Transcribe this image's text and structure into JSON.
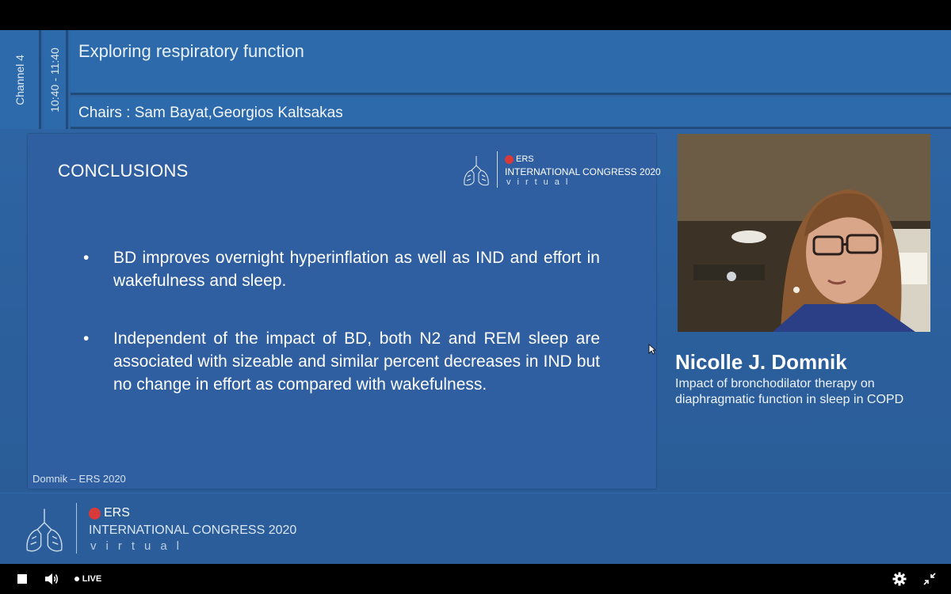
{
  "session": {
    "channel": "Channel 4",
    "time": "10:40 - 11:40",
    "title": "Exploring respiratory function",
    "chairs": "Chairs : Sam Bayat,Georgios Kaltsakas"
  },
  "slide": {
    "title": "CONCLUSIONS",
    "bullet_symbol": "•",
    "bullets": [
      "BD improves overnight hyperinflation as well as IND and effort in wakefulness and sleep.",
      "Independent of the impact of BD, both N2 and REM sleep are associated with sizeable and similar percent decreases in IND but no change in effort as compared with wakefulness."
    ],
    "footer": "Domnik – ERS 2020"
  },
  "logo": {
    "ers": "ERS",
    "congress": "INTERNATIONAL CONGRESS 2020",
    "virtual": "virtual"
  },
  "speaker": {
    "name": "Nicolle J. Domnik",
    "talk_title": "Impact of bronchodilator therapy on diaphragmatic function in sleep in COPD"
  },
  "player": {
    "live_label": "LIVE",
    "icons": [
      "stop-icon",
      "volume-icon",
      "live-dot-icon",
      "gear-icon",
      "exit-fullscreen-icon"
    ]
  },
  "colors": {
    "stage_blue": "#2b5f9c",
    "slide_blue": "#2f5fa0",
    "ers_red": "#d83a3a"
  }
}
